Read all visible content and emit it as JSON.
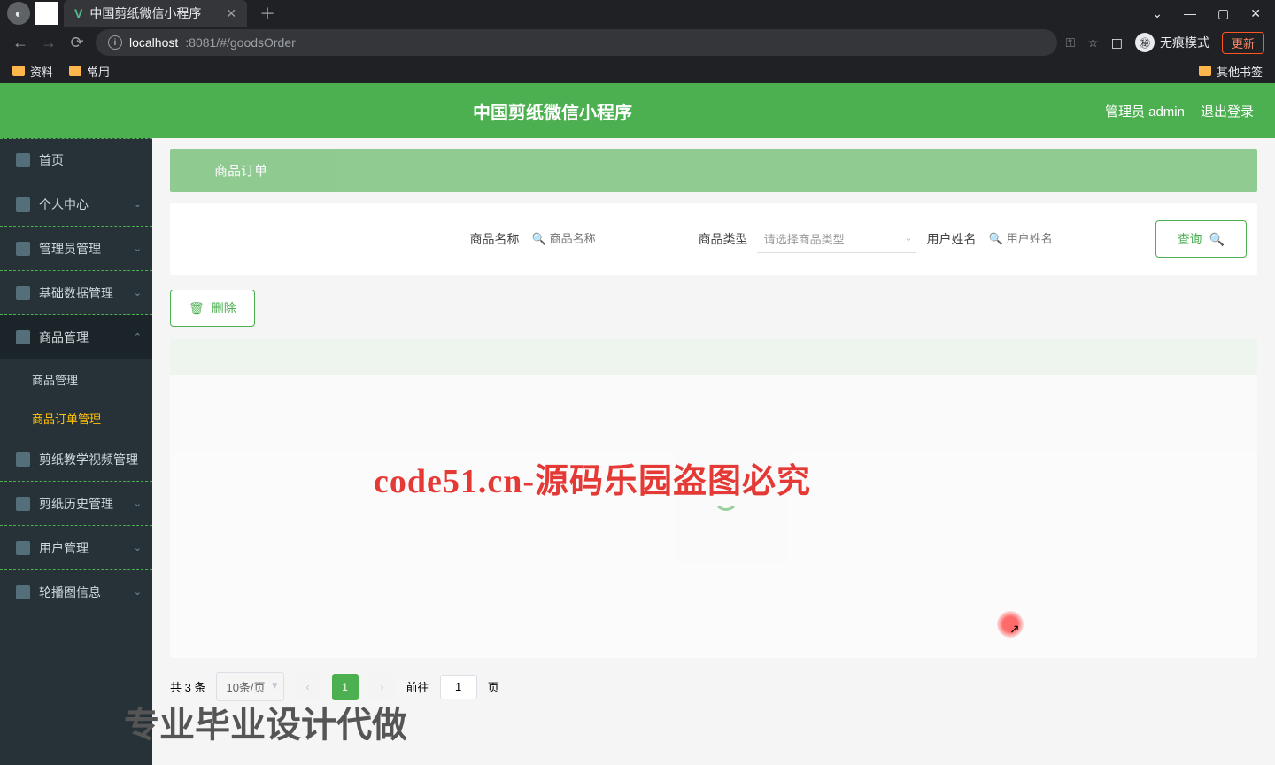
{
  "browser": {
    "tab_title": "中国剪纸微信小程序",
    "url_host": "localhost",
    "url_path": ":8081/#/goodsOrder",
    "incognito": "无痕模式",
    "update": "更新",
    "bookmarks": [
      "资料",
      "常用"
    ],
    "other_bm": "其他书签"
  },
  "header": {
    "title": "中国剪纸微信小程序",
    "user_role": "管理员 admin",
    "logout": "退出登录"
  },
  "sidebar": {
    "items": [
      {
        "label": "首页",
        "expandable": false
      },
      {
        "label": "个人中心",
        "expandable": true
      },
      {
        "label": "管理员管理",
        "expandable": true
      },
      {
        "label": "基础数据管理",
        "expandable": true
      },
      {
        "label": "商品管理",
        "expandable": true,
        "open": true,
        "children": [
          {
            "label": "商品管理",
            "active": false
          },
          {
            "label": "商品订单管理",
            "active": true
          }
        ]
      },
      {
        "label": "剪纸教学视频管理",
        "expandable": false
      },
      {
        "label": "剪纸历史管理",
        "expandable": true
      },
      {
        "label": "用户管理",
        "expandable": true
      },
      {
        "label": "轮播图信息",
        "expandable": true
      }
    ]
  },
  "breadcrumb": "商品订单",
  "filter": {
    "name_label": "商品名称",
    "name_placeholder": "商品名称",
    "type_label": "商品类型",
    "type_placeholder": "请选择商品类型",
    "user_label": "用户姓名",
    "user_placeholder": "用户姓名",
    "search_btn": "查询"
  },
  "actions": {
    "delete": "删除"
  },
  "pager": {
    "total": "共 3 条",
    "page_size": "10条/页",
    "current": "1",
    "goto_label": "前往",
    "goto_value": "1",
    "goto_suffix": "页"
  },
  "watermark": {
    "text": "code51.cn",
    "big1": "code51.cn-源码乐园盗图必究",
    "big2": "专业毕业设计代做"
  }
}
